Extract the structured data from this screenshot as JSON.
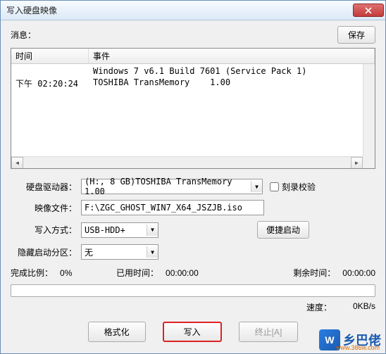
{
  "window": {
    "title": "写入硬盘映像"
  },
  "top": {
    "message_label": "消息：",
    "save_label": "保存"
  },
  "list": {
    "header_time": "时间",
    "header_event": "事件",
    "rows": [
      {
        "time": "",
        "event": "Windows 7 v6.1 Build 7601 (Service Pack 1)"
      },
      {
        "time": "下午 02:20:24",
        "event": "TOSHIBA TransMemory    1.00"
      }
    ]
  },
  "form": {
    "drive_label": "硬盘驱动器：",
    "drive_value": "(H:, 8 GB)TOSHIBA TransMemory    1.00",
    "verify_label": "刻录校验",
    "image_label": "映像文件：",
    "image_value": "F:\\ZGC_GHOST_WIN7_X64_JSZJB.iso",
    "method_label": "写入方式：",
    "method_value": "USB-HDD+",
    "quick_label": "便捷启动",
    "hidden_label": "隐藏启动分区：",
    "hidden_value": "无"
  },
  "progress": {
    "ratio_label": "完成比例：",
    "ratio_value": "0%",
    "elapsed_label": "已用时间：",
    "elapsed_value": "00:00:00",
    "remain_label": "剩余时间：",
    "remain_value": "00:00:00",
    "speed_label": "速度：",
    "speed_value": "0KB/s"
  },
  "buttons": {
    "format": "格式化",
    "write": "写入",
    "abort": "终止[A]"
  },
  "watermark": {
    "brand": "乡巴佬",
    "url": "www.386w.com"
  }
}
